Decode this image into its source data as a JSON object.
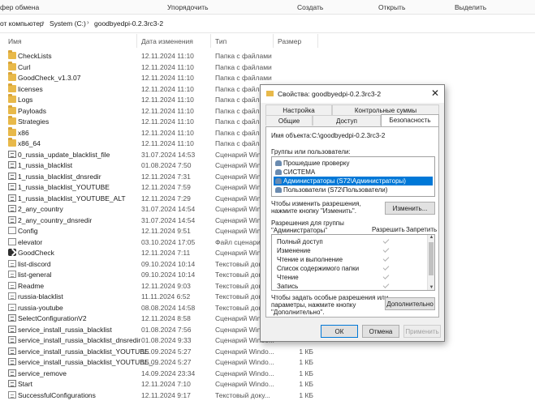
{
  "ribbon": {
    "left": "фер обмена",
    "organize": "Упорядочить",
    "create": "Создать",
    "open": "Открыть",
    "select": "Выделить"
  },
  "address": {
    "crumb1": "от компьютер",
    "crumb2": "System (C:)",
    "crumb3": "goodbyedpi-0.2.3rc3-2"
  },
  "columns": {
    "name": "Имя",
    "date": "Дата изменения",
    "type": "Тип",
    "size": "Размер"
  },
  "files": [
    {
      "name": "CheckLists",
      "date": "12.11.2024 11:10",
      "type": "Папка с файлами",
      "size": "",
      "icon": "folder"
    },
    {
      "name": "Curl",
      "date": "12.11.2024 11:10",
      "type": "Папка с файлами",
      "size": "",
      "icon": "folder"
    },
    {
      "name": "GoodCheck_v1.3.07",
      "date": "12.11.2024 11:10",
      "type": "Папка с файлами",
      "size": "",
      "icon": "folder"
    },
    {
      "name": "licenses",
      "date": "12.11.2024 11:10",
      "type": "Папка с файлами",
      "size": "",
      "icon": "folder"
    },
    {
      "name": "Logs",
      "date": "12.11.2024 11:10",
      "type": "Папка с файлами",
      "size": "",
      "icon": "folder"
    },
    {
      "name": "Payloads",
      "date": "12.11.2024 11:10",
      "type": "Папка с файлами",
      "size": "",
      "icon": "folder"
    },
    {
      "name": "Strategies",
      "date": "12.11.2024 11:10",
      "type": "Папка с файлами",
      "size": "",
      "icon": "folder"
    },
    {
      "name": "x86",
      "date": "12.11.2024 11:10",
      "type": "Папка с файлами",
      "size": "",
      "icon": "folder"
    },
    {
      "name": "x86_64",
      "date": "12.11.2024 11:10",
      "type": "Папка с файлами",
      "size": "",
      "icon": "folder"
    },
    {
      "name": "0_russia_update_blacklist_file",
      "date": "31.07.2024 14:53",
      "type": "Сценарий Windo...",
      "size": "",
      "icon": "script"
    },
    {
      "name": "1_russia_blacklist",
      "date": "01.08.2024 7:50",
      "type": "Сценарий Windo...",
      "size": "",
      "icon": "script"
    },
    {
      "name": "1_russia_blacklist_dnsredir",
      "date": "12.11.2024 7:31",
      "type": "Сценарий Windo...",
      "size": "",
      "icon": "script"
    },
    {
      "name": "1_russia_blacklist_YOUTUBE",
      "date": "12.11.2024 7:59",
      "type": "Сценарий Windo...",
      "size": "",
      "icon": "script"
    },
    {
      "name": "1_russia_blacklist_YOUTUBE_ALT",
      "date": "12.11.2024 7:29",
      "type": "Сценарий Windo...",
      "size": "",
      "icon": "script"
    },
    {
      "name": "2_any_country",
      "date": "31.07.2024 14:54",
      "type": "Сценарий Windo...",
      "size": "",
      "icon": "script"
    },
    {
      "name": "2_any_country_dnsredir",
      "date": "31.07.2024 14:54",
      "type": "Сценарий Windo...",
      "size": "",
      "icon": "script"
    },
    {
      "name": "Config",
      "date": "12.11.2024 9:51",
      "type": "Сценарий Windo...",
      "size": "",
      "icon": "cfg"
    },
    {
      "name": "elevator",
      "date": "03.10.2024 17:05",
      "type": "Файл сценария",
      "size": "",
      "icon": "cfg"
    },
    {
      "name": "GoodCheck",
      "date": "12.11.2024 7:11",
      "type": "Сценарий Windo...",
      "size": "",
      "icon": "exe"
    },
    {
      "name": "list-discord",
      "date": "09.10.2024 10:14",
      "type": "Текстовый доку...",
      "size": "",
      "icon": "txt"
    },
    {
      "name": "list-general",
      "date": "09.10.2024 10:14",
      "type": "Текстовый доку...",
      "size": "",
      "icon": "txt"
    },
    {
      "name": "Readme",
      "date": "12.11.2024 9:03",
      "type": "Текстовый доку...",
      "size": "",
      "icon": "txt"
    },
    {
      "name": "russia-blacklist",
      "date": "11.11.2024 6:52",
      "type": "Текстовый доку...",
      "size": "",
      "icon": "txt"
    },
    {
      "name": "russia-youtube",
      "date": "08.08.2024 14:58",
      "type": "Текстовый доку...",
      "size": "",
      "icon": "txt"
    },
    {
      "name": "SelectConfigurationV2",
      "date": "12.11.2024 8:58",
      "type": "Сценарий Windo...",
      "size": "",
      "icon": "script"
    },
    {
      "name": "service_install_russia_blacklist",
      "date": "01.08.2024 7:56",
      "type": "Сценарий Windo...",
      "size": "",
      "icon": "script"
    },
    {
      "name": "service_install_russia_blacklist_dnsredir",
      "date": "01.08.2024 9:33",
      "type": "Сценарий Windo...",
      "size": "",
      "icon": "script"
    },
    {
      "name": "service_install_russia_blacklist_YOUTUBE",
      "date": "15.09.2024 5:27",
      "type": "Сценарий Windo...",
      "size": "1 КБ",
      "icon": "script"
    },
    {
      "name": "service_install_russia_blacklist_YOUTUBE_...",
      "date": "15.09.2024 5:27",
      "type": "Сценарий Windo...",
      "size": "1 КБ",
      "icon": "script"
    },
    {
      "name": "service_remove",
      "date": "14.09.2024 23:34",
      "type": "Сценарий Windo...",
      "size": "1 КБ",
      "icon": "script"
    },
    {
      "name": "Start",
      "date": "12.11.2024 7:10",
      "type": "Сценарий Windo...",
      "size": "1 КБ",
      "icon": "script"
    },
    {
      "name": "SuccessfulConfigurations",
      "date": "12.11.2024 9:17",
      "type": "Текстовый доку...",
      "size": "1 КБ",
      "icon": "txt"
    }
  ],
  "dialog": {
    "title": "Свойства: goodbyedpi-0.2.3rc3-2",
    "close": "✕",
    "tabs_top": [
      "Настройка",
      "Контрольные суммы"
    ],
    "tabs_bottom": [
      "Общие",
      "Доступ",
      "Безопасность"
    ],
    "object_label": "Имя объекта:",
    "object_value": "C:\\goodbyedpi-0.2.3rc3-2",
    "groups_label": "Группы или пользователи:",
    "users": [
      "Прошедшие проверку",
      "СИСТЕМА",
      "Администраторы (S72\\Администраторы)",
      "Пользователи (S72\\Пользователи)"
    ],
    "change_hint": "Чтобы изменить разрешения,\nнажмите кнопку \"Изменить\".",
    "change_button": "Изменить...",
    "perm_title": "Разрешения для группы\n\"Администраторы\"",
    "allow": "Разрешить",
    "deny": "Запретить",
    "permissions": [
      "Полный доступ",
      "Изменение",
      "Чтение и выполнение",
      "Список содержимого папки",
      "Чтение",
      "Запись"
    ],
    "special_hint": "Чтобы задать особые разрешения или\nпараметры, нажмите кнопку\n\"Дополнительно\".",
    "advanced_button": "Дополнительно",
    "ok": "ОК",
    "cancel": "Отмена",
    "apply": "Применить"
  }
}
